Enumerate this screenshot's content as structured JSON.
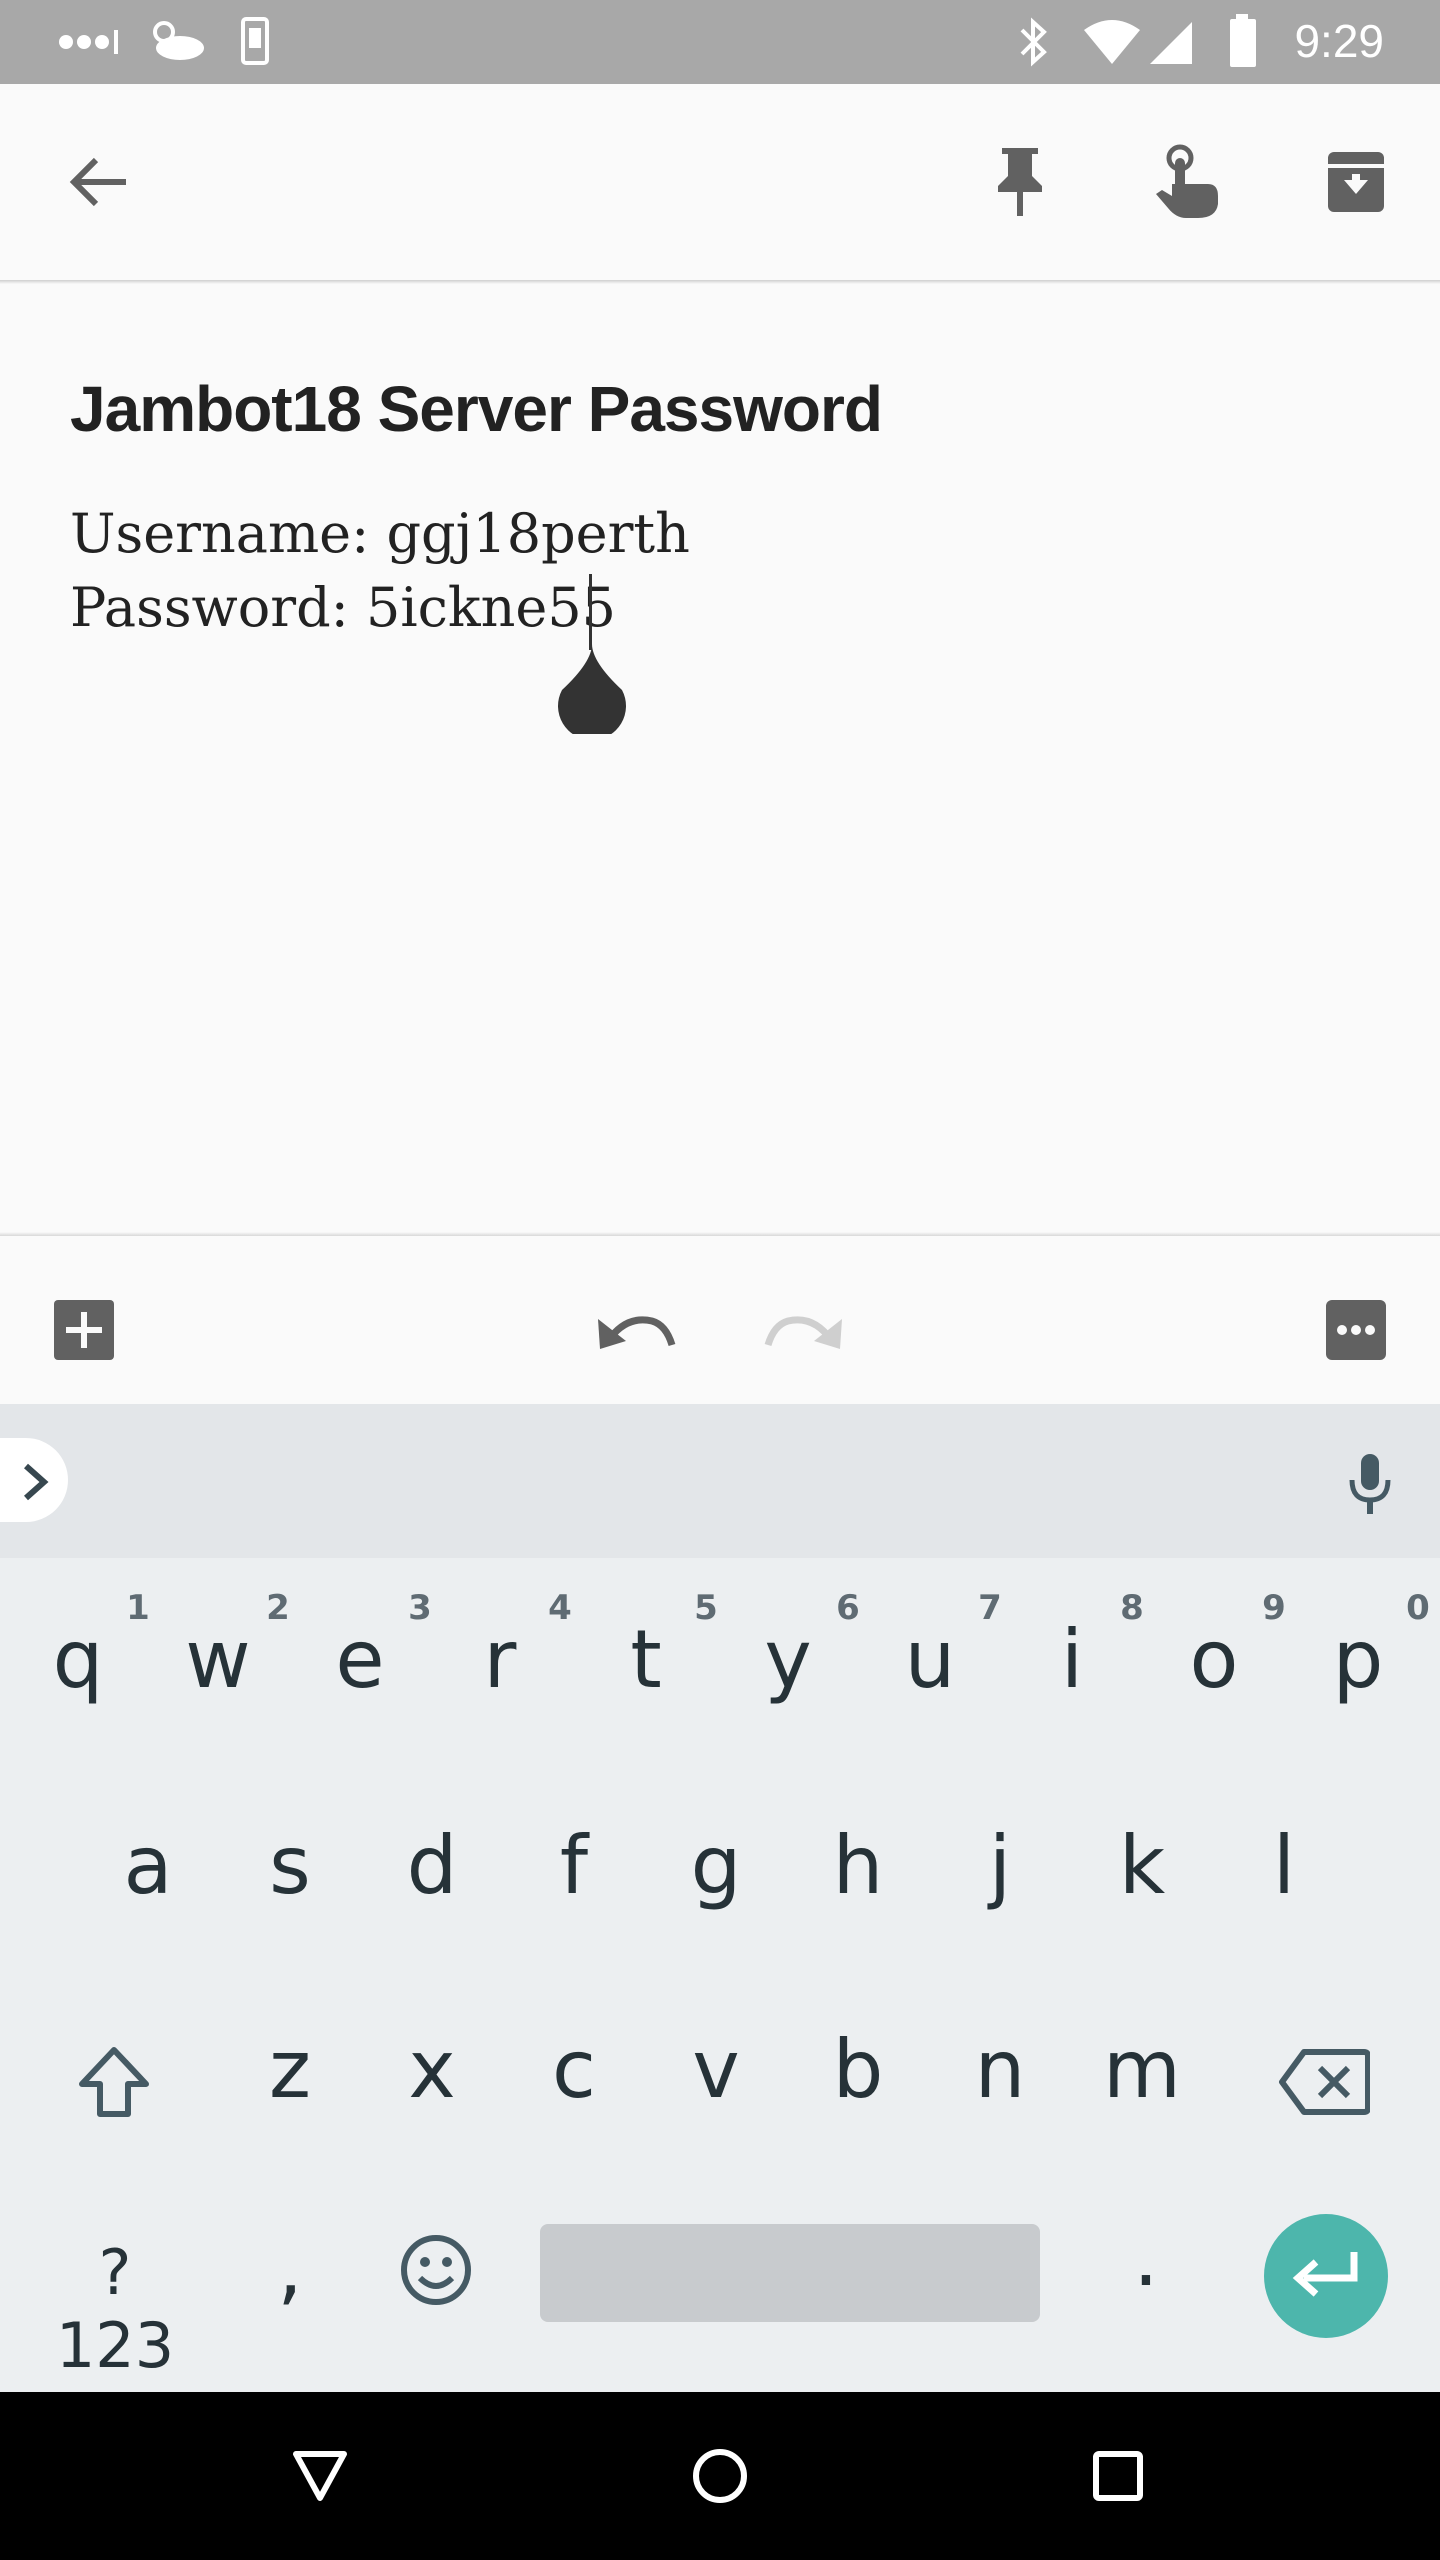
{
  "status_bar": {
    "time": "9:29"
  },
  "toolbar": {
    "back_icon": "arrow-back-icon",
    "pin_icon": "pin-icon",
    "reminder_icon": "reminder-finger-icon",
    "archive_icon": "archive-icon"
  },
  "note": {
    "title": "Jambot18 Server Password",
    "line1": "Username: ggj18perth",
    "line2": "Password: 5ickne55"
  },
  "editor_toolbar": {
    "add_icon": "add-box-icon",
    "undo_icon": "undo-icon",
    "redo_icon": "redo-icon",
    "more_icon": "more-icon"
  },
  "keyboard": {
    "row1": [
      "q",
      "w",
      "e",
      "r",
      "t",
      "y",
      "u",
      "i",
      "o",
      "p"
    ],
    "row1_hints": [
      "1",
      "2",
      "3",
      "4",
      "5",
      "6",
      "7",
      "8",
      "9",
      "0"
    ],
    "row2": [
      "a",
      "s",
      "d",
      "f",
      "g",
      "h",
      "j",
      "k",
      "l"
    ],
    "row3": [
      "z",
      "x",
      "c",
      "v",
      "b",
      "n",
      "m"
    ],
    "symbols_label": "?123",
    "comma": ",",
    "period": ".",
    "accent_color": "#4db6ac"
  }
}
